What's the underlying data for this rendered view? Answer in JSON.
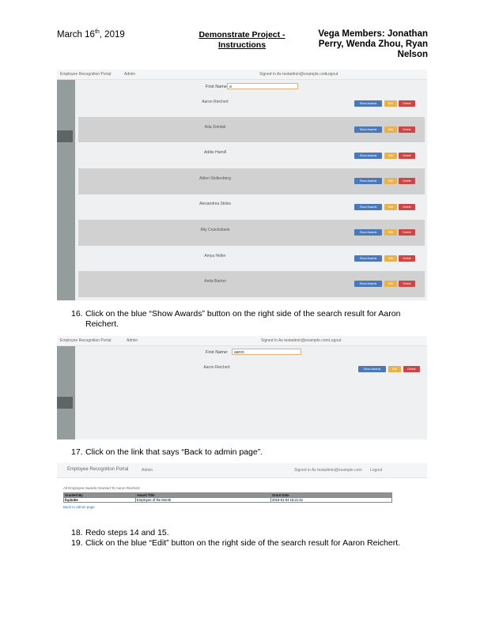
{
  "header": {
    "date_main": "March 16",
    "date_sup": "th",
    "date_year": ", 2019",
    "title": "Demonstrate Project - Instructions",
    "members": "Vega Members: Jonathan Perry, Wenda Zhou, Ryan Nelson"
  },
  "portal": {
    "app_name": "Employee Recognition Portal",
    "admin_label": "Admin",
    "signed_in": "Signed in As testadmin@example.com",
    "logout": "Logout",
    "first_name_label": "First Name:",
    "show_awards": "Show Awards",
    "edit": "Edit",
    "delete": "Delete"
  },
  "shot1": {
    "search_value": "a",
    "results": [
      "Aaron Reichert",
      "Ada Zemlak",
      "Addie Hamill",
      "Alden Stoltenberg",
      "Alexandrea Skiles",
      "Ally Cruickshank",
      "Amya Heller",
      "Anita Barton"
    ]
  },
  "step16": {
    "num": "16.",
    "text": "Click on the blue “Show Awards” button on the right side of the search result for Aaron Reichert."
  },
  "shot2": {
    "search_value": "aaron",
    "results": [
      "Aaron Reichert"
    ]
  },
  "step17": {
    "num": "17.",
    "text": "Click on the link that says “Back to admin page”."
  },
  "shot3": {
    "caption": "All Employee Awards Granted To Aaron Reichert",
    "columns": [
      "Granted By",
      "Award Title",
      "Grant Date"
    ],
    "rows": [
      [
        "fay.kobe",
        "Employee of the Month",
        "2019-01-04 16:21:42"
      ]
    ],
    "back_link": "Back to admin page"
  },
  "step18": {
    "num": "18.",
    "text": "Redo steps 14 and 15."
  },
  "step19": {
    "num": "19.",
    "text": "Click on the blue “Edit” button on the right side of the search result for Aaron Reichert."
  }
}
